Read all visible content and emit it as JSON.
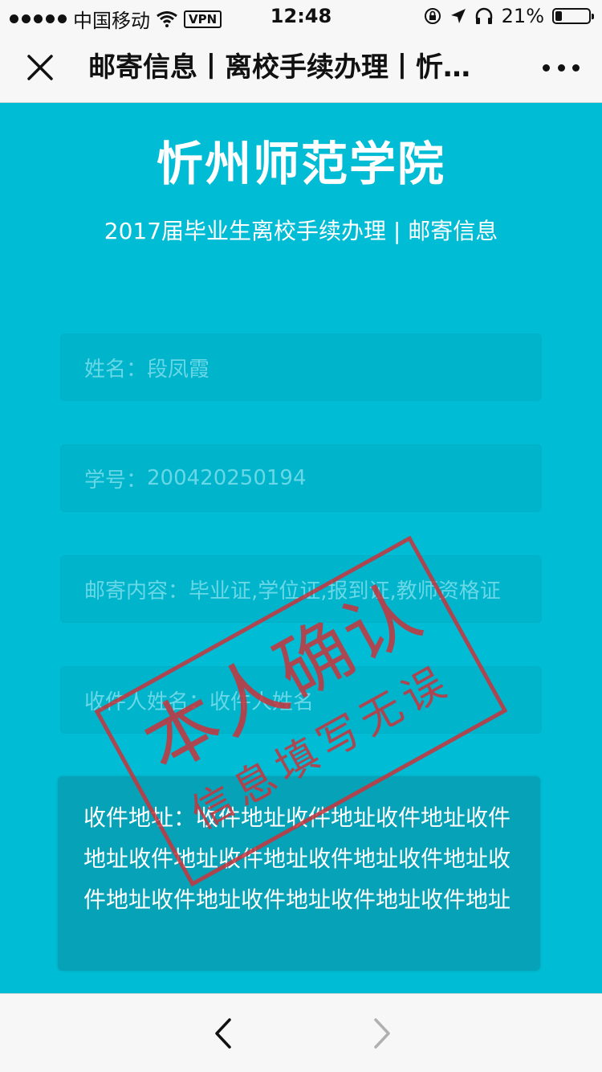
{
  "status_bar": {
    "carrier": "中国移动",
    "vpn": "VPN",
    "time": "12:48",
    "battery_percent": "21%",
    "battery_level": 0.21
  },
  "nav": {
    "title": "邮寄信息丨离校手续办理丨忻…"
  },
  "header": {
    "school_name": "忻州师范学院",
    "subtitle": "2017届毕业生离校手续办理 | 邮寄信息"
  },
  "form": {
    "name": {
      "label": "姓名：",
      "value": "段凤霞"
    },
    "student_id": {
      "label": "学号：",
      "value": "200420250194"
    },
    "mail_content": {
      "label": "邮寄内容：",
      "value": "毕业证,学位证,报到证,教师资格证"
    },
    "recipient_name": {
      "label": "收件人姓名：",
      "value": "收件人姓名"
    },
    "address": {
      "text": "收件地址：收件地址收件地址收件地址收件地址收件地址收件地址收件地址收件地址收件地址收件地址收件地址收件地址收件地址"
    }
  },
  "stamp": {
    "main": "本人确认",
    "sub": "信息填写无误",
    "color": "#c9333b"
  },
  "colors": {
    "background": "#00bcd4",
    "field": "#00b4cc",
    "placeholder_text": "#68d7e6"
  }
}
